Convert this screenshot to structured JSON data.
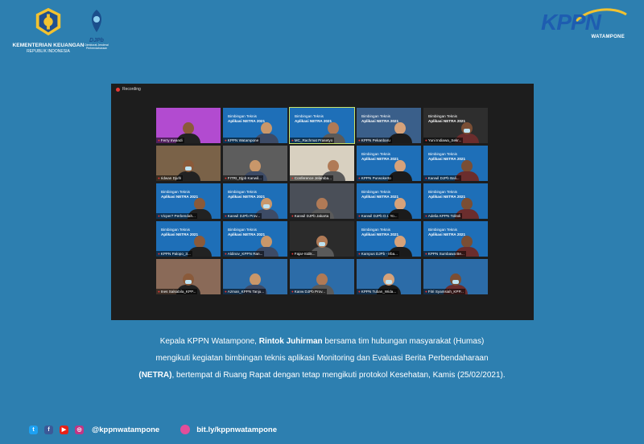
{
  "header": {
    "ministry_line1": "KEMENTERIAN KEUANGAN",
    "ministry_line2": "REPUBLIK INDONESIA",
    "djpb_name": "DJPb",
    "djpb_sub": "Direktorat Jenderal Perbendaharaan",
    "kppn_word": "KPPN",
    "kppn_place": "WATAMPONE"
  },
  "meeting": {
    "recording_label": "Recording",
    "slide_line1": "Bimbingan Teknis",
    "slide_line2": "Aplikasi NETRA 2021",
    "participants": [
      {
        "name": "Ferry Irwandi"
      },
      {
        "name": "KPPN Watampone"
      },
      {
        "name": "MC_Rachmat Prasetyo"
      },
      {
        "name": "KPPN Pekanbaru"
      },
      {
        "name": "Yuni Indiawa_Sekr..."
      },
      {
        "name": "ridwan Djufri"
      },
      {
        "name": "FITRI_Djpb Kanwil..."
      },
      {
        "name": "Conference Jelamba..."
      },
      {
        "name": "KPPN Purwokerto"
      },
      {
        "name": "Kanwil DJPb Bali..."
      },
      {
        "name": "Vicper7 Perbendah..."
      },
      {
        "name": "Kanwil DJPb Prov..."
      },
      {
        "name": "Kanwil DJPb Jakarta"
      },
      {
        "name": "Kanwil DJPb D.I. Yo..."
      },
      {
        "name": "Adelia KPPN Tolitoli"
      },
      {
        "name": "KPPN Palopo_3..."
      },
      {
        "name": "Aldinov_KPPN Ran..."
      },
      {
        "name": "Fajar-Sidik..."
      },
      {
        "name": "Kampus DJPb - Irba..."
      },
      {
        "name": "KPPN Sumbawa Be..."
      },
      {
        "name": "Ines Salsabila_KPP..."
      },
      {
        "name": "Azman_KPPN Tanju..."
      },
      {
        "name": "Kanw DJPb Prov..."
      },
      {
        "name": "KPPN Tuban_Wida..."
      },
      {
        "name": "Fitri Syamsiah_KPP..."
      }
    ]
  },
  "caption": {
    "l1_pre": "Kepala KPPN Watampone, ",
    "l1_bold": "Rintok Juhirman",
    "l1_post": " bersama tim hubungan masyarakat (Humas)",
    "l2": "mengikuti kegiatan bimbingan teknis aplikasi Monitoring dan Evaluasi Berita Perbendaharaan",
    "l3_bold": "(NETRA)",
    "l3_post": ", bertempat di Ruang Rapat dengan tetap mengikuti protokol Kesehatan, Kamis (25/02/2021)."
  },
  "footer": {
    "social_handle": "@kppnwatampone",
    "link": "bit.ly/kppnwatampone"
  },
  "colors": {
    "background": "#2d7fb0",
    "kppn_blue": "#1e5db0",
    "recording_red": "#e53935"
  }
}
